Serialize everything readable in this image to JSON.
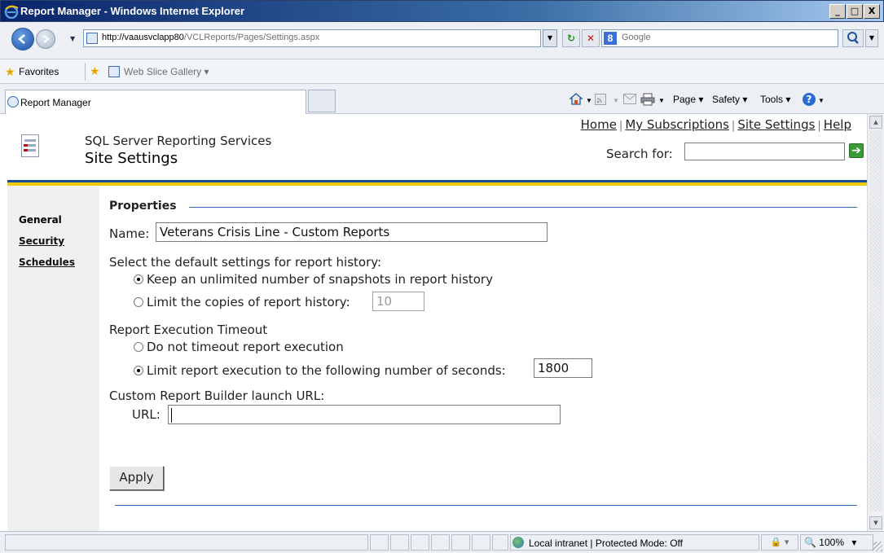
{
  "window": {
    "title": "Report Manager - Windows Internet Explorer",
    "minimize": "_",
    "maximize": "□",
    "close": "X"
  },
  "browser": {
    "url_host": "http://vaausvclapp80",
    "url_path": "/VCLReports/Pages/Settings.aspx",
    "search_placeholder": "Google",
    "favorites_label": "Favorites",
    "web_slice_gallery": "Web Slice Gallery ▾",
    "tab_title": "Report Manager",
    "commands": {
      "page": "Page ▾",
      "safety": "Safety ▾",
      "tools": "Tools ▾"
    }
  },
  "header": {
    "product": "SQL Server Reporting Services",
    "page_title": "Site Settings",
    "links": {
      "home": "Home",
      "subscriptions": "My Subscriptions",
      "site_settings": "Site Settings",
      "help": "Help",
      "separator": "|"
    },
    "search_label": "Search for:",
    "search_value": ""
  },
  "sidebar": {
    "items": [
      {
        "label": "General"
      },
      {
        "label": "Security"
      },
      {
        "label": "Schedules"
      }
    ]
  },
  "properties": {
    "section_title": "Properties",
    "name_label": "Name:",
    "name_value": "Veterans Crisis Line - Custom Reports",
    "history_heading": "Select the default settings for report history:",
    "history_opt_unlimited": "Keep an unlimited number of snapshots in report history",
    "history_opt_limit": "Limit the copies of report history:",
    "history_limit_value": "10",
    "timeout_heading": "Report Execution Timeout",
    "timeout_opt_none": "Do not timeout report execution",
    "timeout_opt_limit": "Limit report execution to the following number of seconds:",
    "timeout_seconds": "1800",
    "builder_heading": "Custom Report Builder launch URL:",
    "url_label": "URL:",
    "url_value": "",
    "apply": "Apply"
  },
  "status": {
    "zone": "Local intranet | Protected Mode: Off",
    "zoom": "100%",
    "zoom_arrow": "▾",
    "prot_arrow": "▾"
  }
}
